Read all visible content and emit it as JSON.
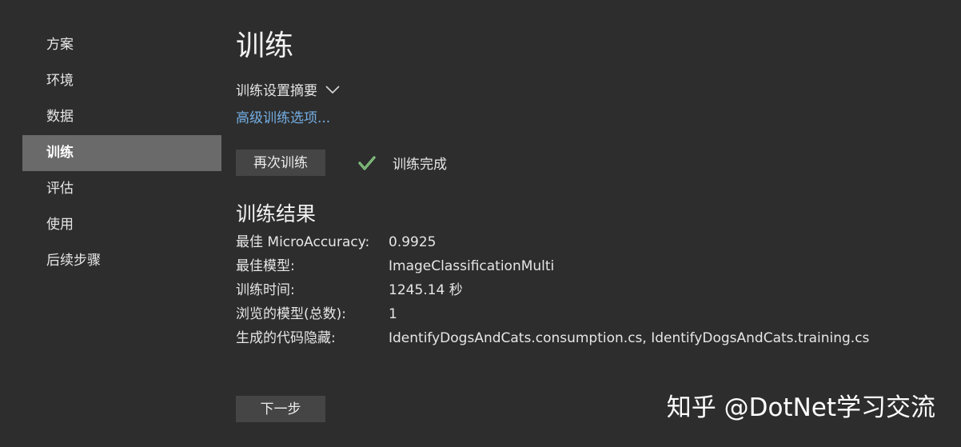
{
  "sidebar": {
    "items": [
      {
        "label": "方案"
      },
      {
        "label": "环境"
      },
      {
        "label": "数据"
      },
      {
        "label": "训练",
        "active": true
      },
      {
        "label": "评估"
      },
      {
        "label": "使用"
      },
      {
        "label": "后续步骤"
      }
    ]
  },
  "main": {
    "title": "训练",
    "summary_toggle": "训练设置摘要",
    "advanced_link": "高级训练选项...",
    "retrain_button": "再次训练",
    "status_text": "训练完成",
    "results_title": "训练结果",
    "results": [
      {
        "label": "最佳 MicroAccuracy:",
        "value": "0.9925"
      },
      {
        "label": "最佳模型:",
        "value": "ImageClassificationMulti"
      },
      {
        "label": "训练时间:",
        "value": "1245.14 秒"
      },
      {
        "label": "浏览的模型(总数):",
        "value": "1"
      },
      {
        "label": "生成的代码隐藏:",
        "value": "IdentifyDogsAndCats.consumption.cs, IdentifyDogsAndCats.training.cs"
      }
    ],
    "next_button": "下一步"
  },
  "watermark": "知乎 @DotNet学习交流",
  "colors": {
    "background": "#2d2d2d",
    "active_nav": "#6a6a6a",
    "link": "#74aee4",
    "check": "#8fd18b",
    "button": "#454545"
  },
  "icons": {
    "summary_chevron": "chevron-down-icon",
    "status": "check-icon"
  }
}
